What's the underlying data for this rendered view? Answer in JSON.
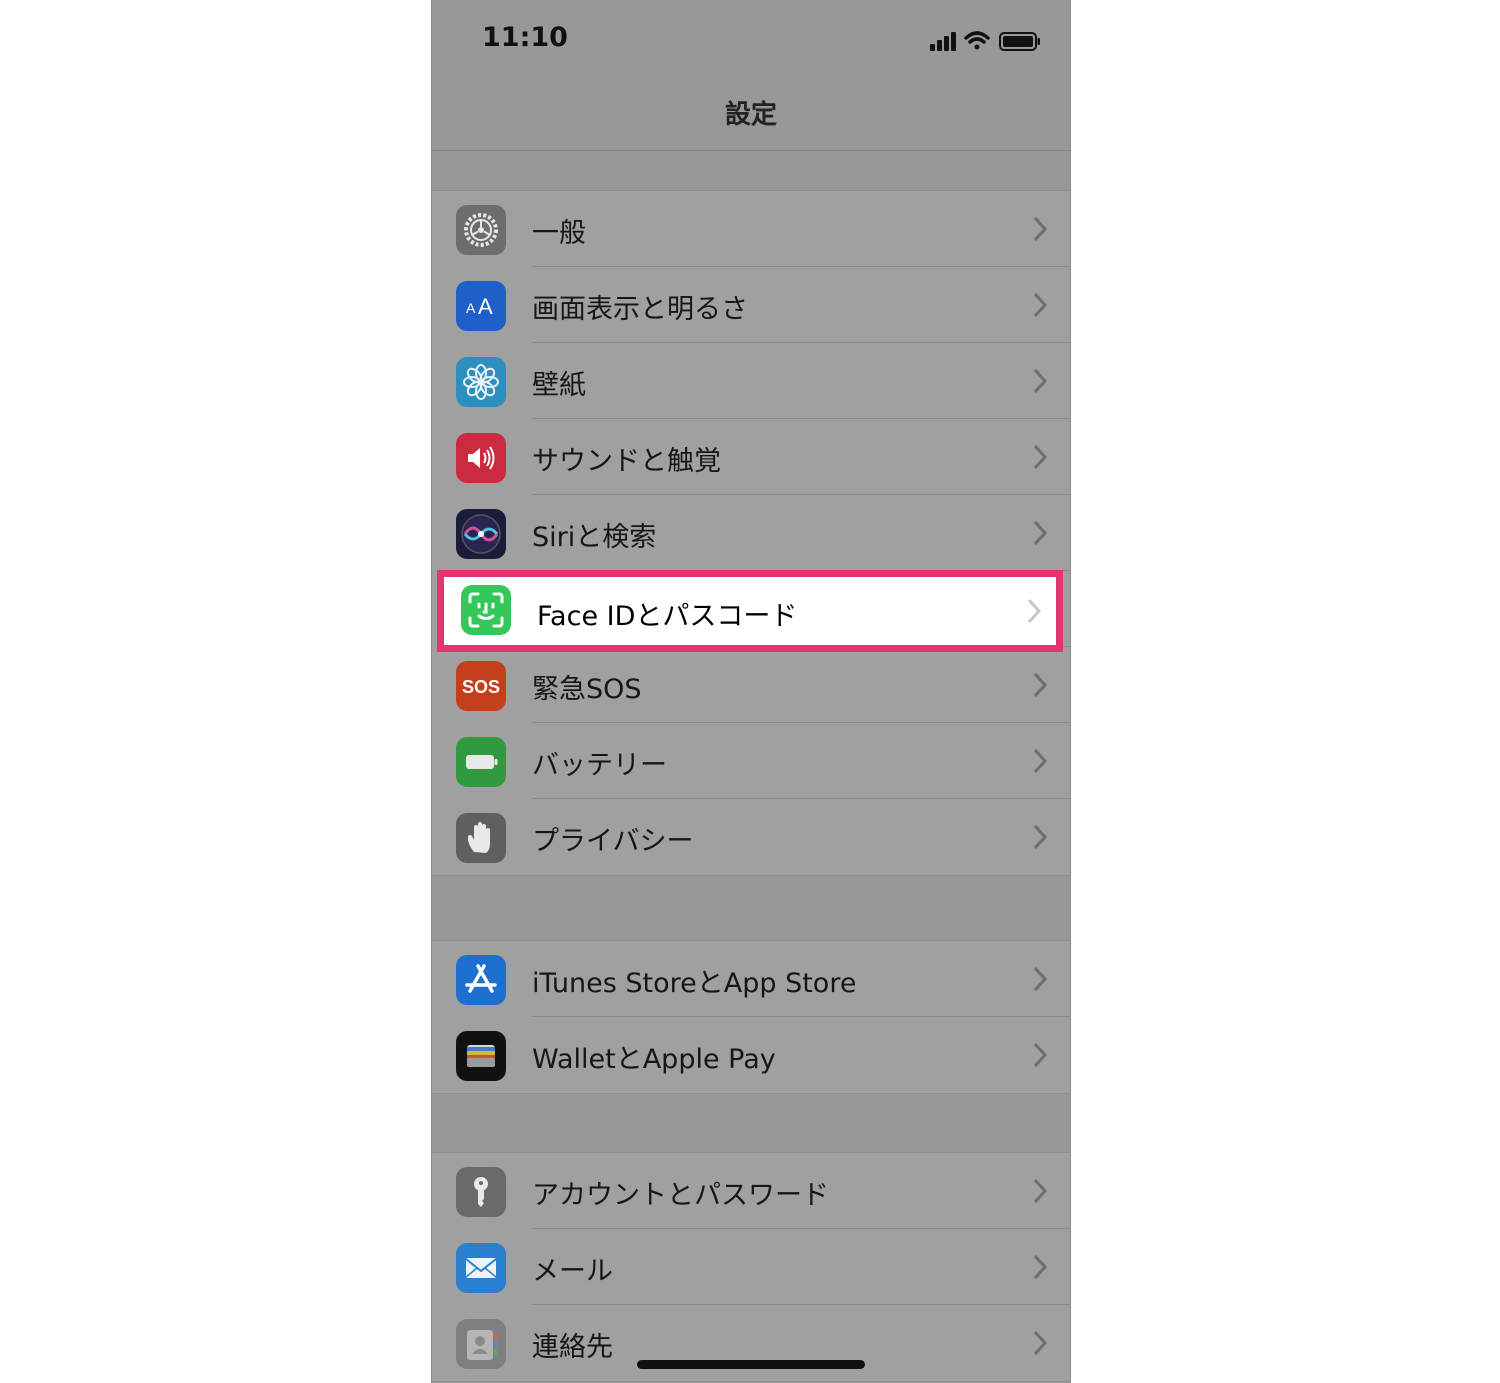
{
  "status_bar": {
    "time": "11:10"
  },
  "nav": {
    "title": "設定"
  },
  "groups": [
    {
      "items": [
        {
          "label": "一般",
          "icon": "gear-icon",
          "color": "#6d6d70"
        },
        {
          "label": "画面表示と明るさ",
          "icon": "text-size-icon",
          "color": "#1f5fc8"
        },
        {
          "label": "壁紙",
          "icon": "flower-icon",
          "color": "#2d8fbf"
        },
        {
          "label": "サウンドと触覚",
          "icon": "speaker-icon",
          "color": "#cc2b3f"
        },
        {
          "label": "Siriと検索",
          "icon": "siri-icon",
          "color": "#1b1b3a"
        },
        {
          "label": "Face IDとパスコード",
          "icon": "face-id-icon",
          "color": "#34c759",
          "highlighted": true
        },
        {
          "label": "緊急SOS",
          "icon": "sos-icon",
          "color": "#c43f1c",
          "icon_text": "SOS"
        },
        {
          "label": "バッテリー",
          "icon": "battery-icon",
          "color": "#2f9a3f"
        },
        {
          "label": "プライバシー",
          "icon": "hand-icon",
          "color": "#5f5f62"
        }
      ]
    },
    {
      "items": [
        {
          "label": "iTunes StoreとApp Store",
          "icon": "app-store-icon",
          "color": "#1d6fd0"
        },
        {
          "label": "WalletとApple Pay",
          "icon": "wallet-icon",
          "color": "#111111"
        }
      ]
    },
    {
      "items": [
        {
          "label": "アカウントとパスワード",
          "icon": "key-icon",
          "color": "#6a6a6d"
        },
        {
          "label": "メール",
          "icon": "mail-icon",
          "color": "#2a7fd0"
        },
        {
          "label": "連絡先",
          "icon": "contacts-icon",
          "color": "#7f7f82"
        }
      ]
    }
  ],
  "colors": {
    "highlight_border": "#e8346e",
    "overlay_gray": "#a0a0a1"
  }
}
